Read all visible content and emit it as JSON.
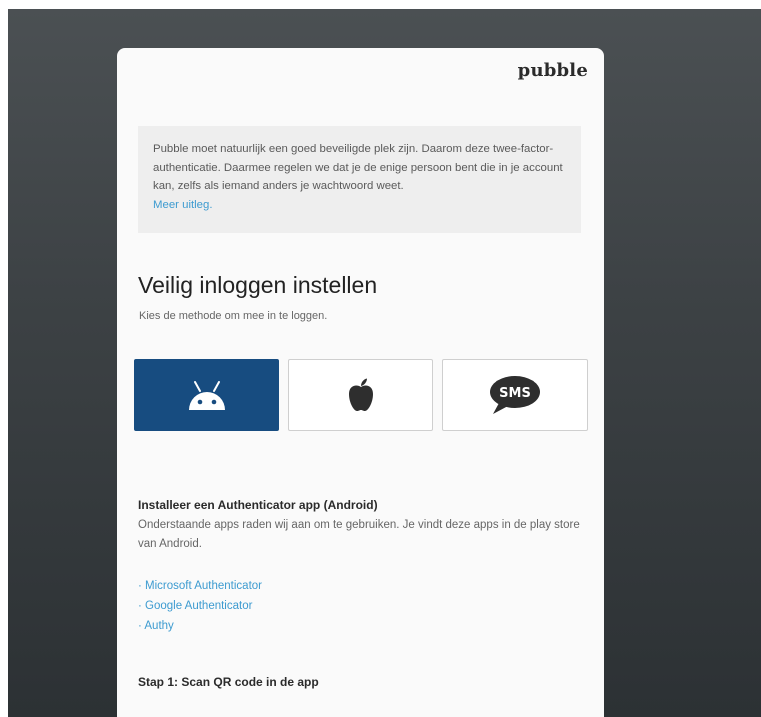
{
  "brand": {
    "name": "pubble"
  },
  "info": {
    "text": "Pubble moet natuurlijk een goed beveiligde plek zijn. Daarom deze twee-factor-authenticatie. Daarmee regelen we dat je de enige persoon bent die in je account kan, zelfs als iemand anders je wachtwoord weet.",
    "link_label": "Meer uitleg."
  },
  "setup": {
    "title": "Veilig inloggen instellen",
    "subtitle": "Kies de methode om mee in te loggen."
  },
  "methods": [
    {
      "icon": "android-icon",
      "selected": true
    },
    {
      "icon": "apple-icon",
      "selected": false
    },
    {
      "icon": "sms-icon",
      "label": "SMS",
      "selected": false
    }
  ],
  "install": {
    "title": "Installeer een Authenticator app (Android)",
    "description": "Onderstaande apps raden wij aan om te gebruiken. Je vindt deze apps in de play store van Android.",
    "apps": [
      "· Microsoft Authenticator",
      "· Google Authenticator",
      "· Authy"
    ]
  },
  "step1": {
    "label": "Stap 1: Scan QR code in de app"
  },
  "colors": {
    "accent": "#174c80",
    "link": "#3d9bd0",
    "backdrop": "#3d4245",
    "card": "#fafafa",
    "info_bg": "#eeeeee"
  }
}
